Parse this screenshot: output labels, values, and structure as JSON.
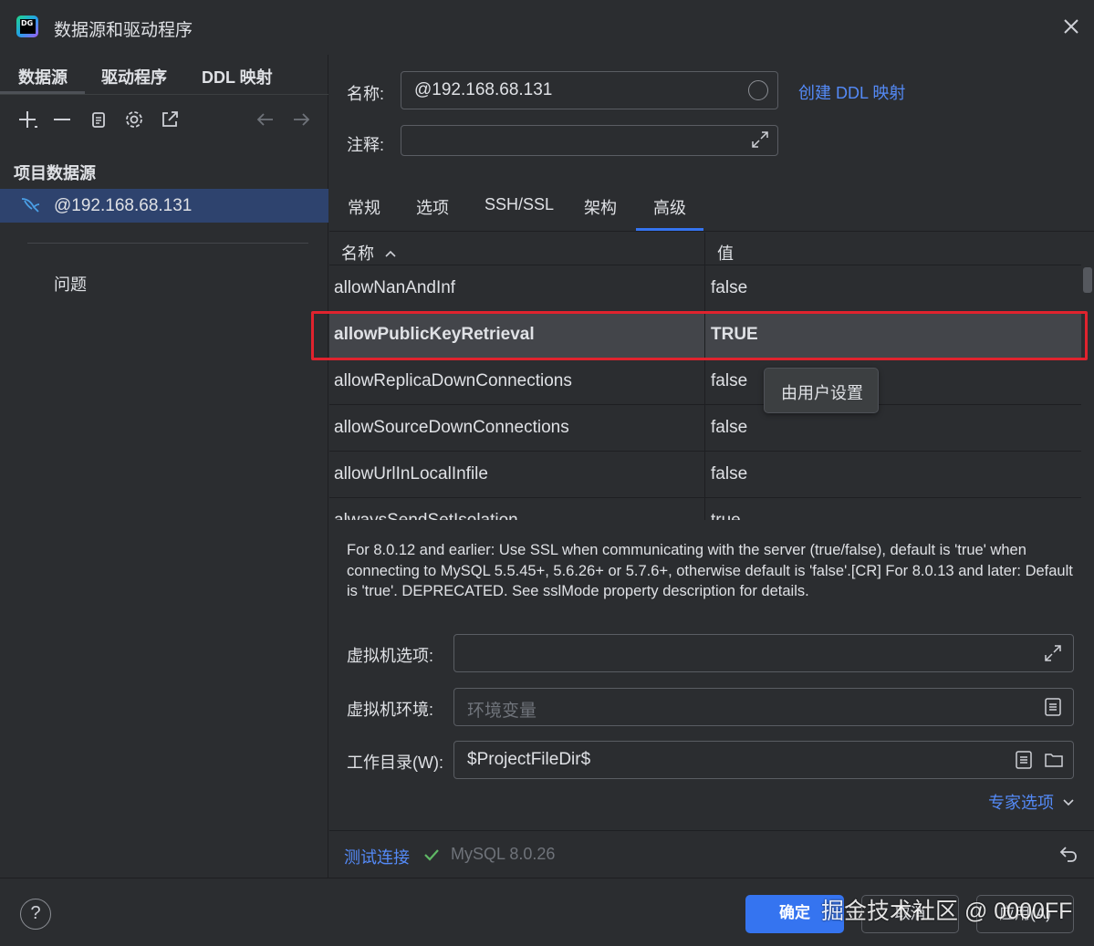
{
  "window": {
    "title": "数据源和驱动程序",
    "close_icon": "close-icon"
  },
  "left": {
    "tabs": [
      "数据源",
      "驱动程序",
      "DDL 映射"
    ],
    "section_title": "项目数据源",
    "datasource": "@192.168.68.131",
    "problems": "问题"
  },
  "form": {
    "name_label": "名称:",
    "name_value": "@192.168.68.131",
    "comment_label": "注释:",
    "comment_value": "",
    "create_ddl_link": "创建 DDL 映射"
  },
  "tabs": [
    "常规",
    "选项",
    "SSH/SSL",
    "架构",
    "高级"
  ],
  "active_tab": "高级",
  "table": {
    "header_name": "名称",
    "header_value": "值",
    "rows": [
      {
        "name": "allowNanAndInf",
        "value": "false"
      },
      {
        "name": "allowPublicKeyRetrieval",
        "value": "TRUE"
      },
      {
        "name": "allowReplicaDownConnections",
        "value": "false"
      },
      {
        "name": "allowSourceDownConnections",
        "value": "false"
      },
      {
        "name": "allowUrlInLocalInfile",
        "value": "false"
      },
      {
        "name": "alwaysSendSetIsolation",
        "value": "true"
      }
    ],
    "selected_row": "allowPublicKeyRetrieval",
    "tooltip": "由用户设置"
  },
  "description": "For 8.0.12 and earlier: Use SSL when communicating with the server (true/false), default is 'true' when connecting to MySQL 5.5.45+, 5.6.26+ or 5.7.6+, otherwise default is 'false'.[CR] For 8.0.13 and later: Default is 'true'. DEPRECATED. See sslMode property description for details.",
  "vm": {
    "options_label": "虚拟机选项:",
    "options_value": "",
    "env_label": "虚拟机环境:",
    "env_placeholder": "环境变量",
    "workdir_label": "工作目录(W):",
    "workdir_value": "$ProjectFileDir$"
  },
  "expert_options": "专家选项",
  "status": {
    "test_connection": "测试连接",
    "mysql_version": "MySQL 8.0.26"
  },
  "buttons": {
    "ok": "确定",
    "cancel": "取消",
    "apply": "应用(A)",
    "help": "?"
  },
  "watermark": "掘金技术社区 @ 0000FF",
  "colors": {
    "accent": "#3574f0",
    "link": "#548af7",
    "highlight_border": "#e0232e",
    "selection": "#2e436e"
  }
}
